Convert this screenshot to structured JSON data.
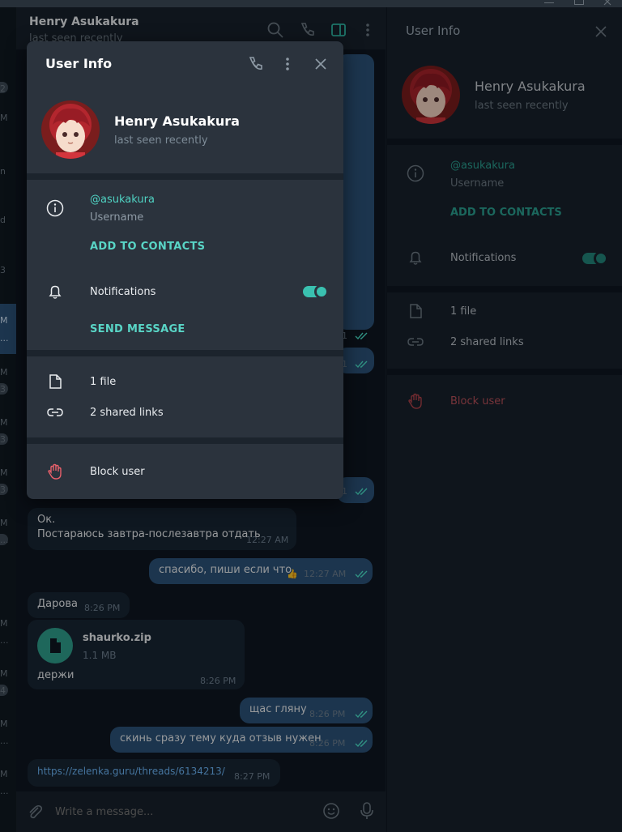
{
  "chat_list_fragments": [
    "2",
    "M",
    "n",
    "d",
    "3",
    "M",
    "...",
    "M",
    "3",
    "M",
    "3",
    "M",
    "3",
    "M",
    "...",
    "M",
    "...",
    "M",
    "4",
    "M",
    "...",
    "M",
    "..."
  ],
  "chat": {
    "header": {
      "name": "Henry Asukakura",
      "status": "last seen recently"
    },
    "messages": [
      {
        "dir": "in",
        "text": "Ок.",
        "text2": "Постараюсь завтра-послезавтра отдать",
        "time": "12:27 AM"
      },
      {
        "dir": "out",
        "text": "спасибо, пиши если что",
        "reaction": "👍",
        "time": "12:27 AM",
        "read": true
      },
      {
        "dir": "in",
        "text": "Дарова",
        "time": "8:26 PM"
      },
      {
        "dir": "in",
        "type": "file",
        "file_name": "shaurko.zip",
        "file_size": "1.1 MB",
        "caption": "держи",
        "time": "8:26 PM"
      },
      {
        "dir": "out",
        "text": "щас гляну",
        "time": "8:26 PM",
        "read": true
      },
      {
        "dir": "out",
        "text": "скинь сразу тему куда отзыв нужен",
        "time": "8:26 PM",
        "read": true
      },
      {
        "dir": "in",
        "type": "link",
        "text": "https://zelenka.guru/threads/6134213/",
        "time": "8:27 PM"
      }
    ],
    "hidden_times": [
      "1",
      "1",
      "1"
    ],
    "input_placeholder": "Write a message..."
  },
  "right_panel": {
    "title": "User Info",
    "name": "Henry Asukakura",
    "status": "last seen recently",
    "username": "@asukakura",
    "username_label": "Username",
    "add_contacts": "ADD TO CONTACTS",
    "notifications_label": "Notifications",
    "notifications_on": true,
    "files": "1 file",
    "links": "2 shared links",
    "block": "Block user"
  },
  "modal": {
    "title": "User Info",
    "name": "Henry Asukakura",
    "status": "last seen recently",
    "username": "@asukakura",
    "username_label": "Username",
    "add_contacts": "ADD TO CONTACTS",
    "notifications_label": "Notifications",
    "notifications_on": true,
    "send_message": "SEND MESSAGE",
    "files": "1 file",
    "links": "2 shared links",
    "block": "Block user"
  },
  "colors": {
    "accent": "#2fb5a4",
    "danger": "#e8606b",
    "link": "#6ab3f3",
    "panel": "#2b333d",
    "bg": "#0e1621"
  }
}
